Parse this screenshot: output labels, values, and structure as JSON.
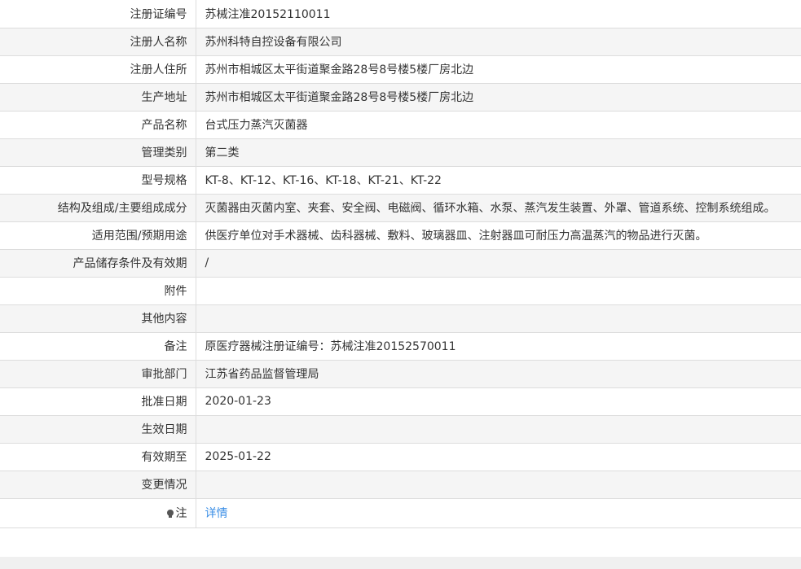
{
  "rows": [
    {
      "label": "注册证编号",
      "value": "苏械注准20152110011"
    },
    {
      "label": "注册人名称",
      "value": "苏州科特自控设备有限公司"
    },
    {
      "label": "注册人住所",
      "value": "苏州市相城区太平街道聚金路28号8号楼5楼厂房北边"
    },
    {
      "label": "生产地址",
      "value": "苏州市相城区太平街道聚金路28号8号楼5楼厂房北边"
    },
    {
      "label": "产品名称",
      "value": "台式压力蒸汽灭菌器"
    },
    {
      "label": "管理类别",
      "value": "第二类"
    },
    {
      "label": "型号规格",
      "value": "KT-8、KT-12、KT-16、KT-18、KT-21、KT-22"
    },
    {
      "label": "结构及组成/主要组成成分",
      "value": "灭菌器由灭菌内室、夹套、安全阀、电磁阀、循环水箱、水泵、蒸汽发生装置、外罩、管道系统、控制系统组成。"
    },
    {
      "label": "适用范围/预期用途",
      "value": "供医疗单位对手术器械、齿科器械、敷料、玻璃器皿、注射器皿可耐压力高温蒸汽的物品进行灭菌。"
    },
    {
      "label": "产品储存条件及有效期",
      "value": "/"
    },
    {
      "label": "附件",
      "value": ""
    },
    {
      "label": "其他内容",
      "value": ""
    },
    {
      "label": "备注",
      "value": "原医疗器械注册证编号：苏械注准20152570011"
    },
    {
      "label": "审批部门",
      "value": "江苏省药品监督管理局"
    },
    {
      "label": "批准日期",
      "value": "2020-01-23"
    },
    {
      "label": "生效日期",
      "value": ""
    },
    {
      "label": "有效期至",
      "value": "2025-01-22"
    },
    {
      "label": "变更情况",
      "value": ""
    }
  ],
  "note_row": {
    "label": "注",
    "link": "详情",
    "icon": "lightbulb-icon"
  }
}
